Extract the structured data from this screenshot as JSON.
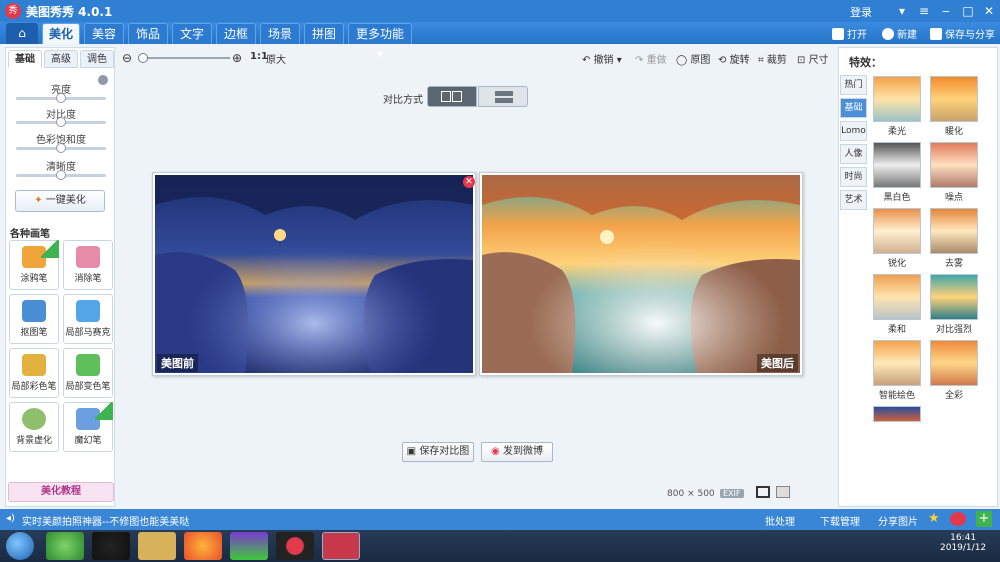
{
  "app": {
    "title": "美图秀秀 4.0.1",
    "logo_text": "秀",
    "login": "登录"
  },
  "window_controls": [
    "‒",
    "□",
    "✕"
  ],
  "menubar": {
    "home_icon": "home-icon",
    "tabs": [
      {
        "label": "美化",
        "active": true
      },
      {
        "label": "美容"
      },
      {
        "label": "饰品"
      },
      {
        "label": "文字"
      },
      {
        "label": "边框"
      },
      {
        "label": "场景"
      },
      {
        "label": "拼图"
      },
      {
        "label": "更多功能 ▾"
      }
    ],
    "open": "打开",
    "new": "新建",
    "save_share": "保存与分享"
  },
  "left_panel": {
    "subtabs": [
      "基础",
      "高级",
      "调色"
    ],
    "sliders": [
      {
        "label": "亮度",
        "value": 0.5
      },
      {
        "label": "对比度",
        "value": 0.5
      },
      {
        "label": "色彩饱和度",
        "value": 0.5
      },
      {
        "label": "清晰度",
        "value": 0.5
      }
    ],
    "one_click": "一键美化",
    "brushes_title": "各种画笔",
    "brushes": [
      {
        "label": "涂鸦笔",
        "color": "#f0a53a",
        "badge": "升级"
      },
      {
        "label": "消除笔",
        "color": "#e58ca8"
      },
      {
        "label": "抠图笔",
        "color": "#4a8fd6"
      },
      {
        "label": "局部马赛克",
        "color": "#53a5e8"
      },
      {
        "label": "局部彩色笔",
        "color": "#e3b13d"
      },
      {
        "label": "局部变色笔",
        "color": "#5fbf5a"
      },
      {
        "label": "背景虚化",
        "color": "#8fbf6d"
      },
      {
        "label": "魔幻笔",
        "color": "#6b9fe0",
        "badge": "new"
      }
    ],
    "tutorial": "美化教程"
  },
  "toolbar": {
    "ratio": "1:1",
    "original_size": "原大",
    "undo": "撤销",
    "redo": "重做",
    "original": "原图",
    "rotate": "旋转",
    "crop": "裁剪",
    "size": "尺寸"
  },
  "compare": {
    "label": "对比方式"
  },
  "images": {
    "before_label": "美图前",
    "after_label": "美图后",
    "dimensions_w": "800",
    "dimensions_x": "×",
    "dimensions_h": "500",
    "exif": "EXIF"
  },
  "actions": {
    "save_compare": "保存对比图",
    "weibo": "发到微博"
  },
  "right_panel": {
    "title": "特效：",
    "categories": [
      {
        "label": "热门"
      },
      {
        "label": "基础",
        "active": true
      },
      {
        "label": "Lomo"
      },
      {
        "label": "人像"
      },
      {
        "label": "时尚"
      },
      {
        "label": "艺术"
      }
    ],
    "effects": [
      "柔光",
      "暖化",
      "黑白色",
      "噪点",
      "锐化",
      "去雾",
      "柔和",
      "对比强烈",
      "智能绘色",
      "全彩"
    ]
  },
  "statusbar": {
    "tip": "实时美颜拍照神器--不修图也能美美哒",
    "batch": "批处理",
    "download": "下载管理",
    "share": "分享图片"
  },
  "taskbar": {
    "time": "16:41",
    "date": "2019/1/12"
  },
  "colors": {
    "title_blue": "#2f7fd3",
    "accent": "#e23a4c"
  }
}
